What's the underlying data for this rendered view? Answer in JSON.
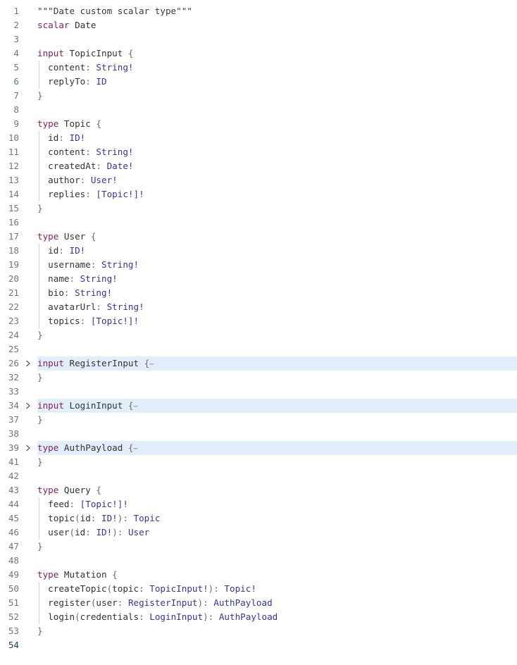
{
  "editor": {
    "lines": [
      {
        "n": "1",
        "tokens": [
          [
            "string",
            "\"\"\"Date custom scalar type\"\"\""
          ]
        ]
      },
      {
        "n": "2",
        "tokens": [
          [
            "keyword",
            "scalar"
          ],
          [
            "plain",
            " Date"
          ]
        ]
      },
      {
        "n": "3",
        "tokens": []
      },
      {
        "n": "4",
        "tokens": [
          [
            "keyword",
            "input"
          ],
          [
            "plain",
            " TopicInput "
          ],
          [
            "punct",
            "{"
          ]
        ]
      },
      {
        "n": "5",
        "guide": true,
        "tokens": [
          [
            "field",
            "  content"
          ],
          [
            "punct",
            ": "
          ],
          [
            "type",
            "String!"
          ]
        ]
      },
      {
        "n": "6",
        "guide": true,
        "tokens": [
          [
            "field",
            "  replyTo"
          ],
          [
            "punct",
            ": "
          ],
          [
            "type",
            "ID"
          ]
        ]
      },
      {
        "n": "7",
        "tokens": [
          [
            "punct",
            "}"
          ]
        ]
      },
      {
        "n": "8",
        "tokens": []
      },
      {
        "n": "9",
        "tokens": [
          [
            "keyword",
            "type"
          ],
          [
            "plain",
            " Topic "
          ],
          [
            "punct",
            "{"
          ]
        ]
      },
      {
        "n": "10",
        "guide": true,
        "tokens": [
          [
            "field",
            "  id"
          ],
          [
            "punct",
            ": "
          ],
          [
            "type",
            "ID!"
          ]
        ]
      },
      {
        "n": "11",
        "guide": true,
        "tokens": [
          [
            "field",
            "  content"
          ],
          [
            "punct",
            ": "
          ],
          [
            "type",
            "String!"
          ]
        ]
      },
      {
        "n": "12",
        "guide": true,
        "tokens": [
          [
            "field",
            "  createdAt"
          ],
          [
            "punct",
            ": "
          ],
          [
            "type",
            "Date!"
          ]
        ]
      },
      {
        "n": "13",
        "guide": true,
        "tokens": [
          [
            "field",
            "  author"
          ],
          [
            "punct",
            ": "
          ],
          [
            "type",
            "User!"
          ]
        ]
      },
      {
        "n": "14",
        "guide": true,
        "tokens": [
          [
            "field",
            "  replies"
          ],
          [
            "punct",
            ": "
          ],
          [
            "type",
            "[Topic!]!"
          ]
        ]
      },
      {
        "n": "15",
        "tokens": [
          [
            "punct",
            "}"
          ]
        ]
      },
      {
        "n": "16",
        "tokens": []
      },
      {
        "n": "17",
        "tokens": [
          [
            "keyword",
            "type"
          ],
          [
            "plain",
            " User "
          ],
          [
            "punct",
            "{"
          ]
        ]
      },
      {
        "n": "18",
        "guide": true,
        "tokens": [
          [
            "field",
            "  id"
          ],
          [
            "punct",
            ": "
          ],
          [
            "type",
            "ID!"
          ]
        ]
      },
      {
        "n": "19",
        "guide": true,
        "tokens": [
          [
            "field",
            "  username"
          ],
          [
            "punct",
            ": "
          ],
          [
            "type",
            "String!"
          ]
        ]
      },
      {
        "n": "20",
        "guide": true,
        "tokens": [
          [
            "field",
            "  name"
          ],
          [
            "punct",
            ": "
          ],
          [
            "type",
            "String!"
          ]
        ]
      },
      {
        "n": "21",
        "guide": true,
        "tokens": [
          [
            "field",
            "  bio"
          ],
          [
            "punct",
            ": "
          ],
          [
            "type",
            "String!"
          ]
        ]
      },
      {
        "n": "22",
        "guide": true,
        "tokens": [
          [
            "field",
            "  avatarUrl"
          ],
          [
            "punct",
            ": "
          ],
          [
            "type",
            "String!"
          ]
        ]
      },
      {
        "n": "23",
        "guide": true,
        "tokens": [
          [
            "field",
            "  topics"
          ],
          [
            "punct",
            ": "
          ],
          [
            "type",
            "[Topic!]!"
          ]
        ]
      },
      {
        "n": "24",
        "tokens": [
          [
            "punct",
            "}"
          ]
        ]
      },
      {
        "n": "25",
        "tokens": []
      },
      {
        "n": "26",
        "folded": true,
        "tokens": [
          [
            "keyword",
            "input"
          ],
          [
            "plain",
            " RegisterInput "
          ],
          [
            "punct",
            "{"
          ],
          [
            "ellipsis",
            "⋯"
          ]
        ]
      },
      {
        "n": "32",
        "tokens": [
          [
            "punct",
            "}"
          ]
        ]
      },
      {
        "n": "33",
        "tokens": []
      },
      {
        "n": "34",
        "folded": true,
        "tokens": [
          [
            "keyword",
            "input"
          ],
          [
            "plain",
            " LoginInput "
          ],
          [
            "punct",
            "{"
          ],
          [
            "ellipsis",
            "⋯"
          ]
        ]
      },
      {
        "n": "37",
        "tokens": [
          [
            "punct",
            "}"
          ]
        ]
      },
      {
        "n": "38",
        "tokens": []
      },
      {
        "n": "39",
        "folded": true,
        "tokens": [
          [
            "keyword",
            "type"
          ],
          [
            "plain",
            " AuthPayload "
          ],
          [
            "punct",
            "{"
          ],
          [
            "ellipsis",
            "⋯"
          ]
        ]
      },
      {
        "n": "41",
        "tokens": [
          [
            "punct",
            "}"
          ]
        ]
      },
      {
        "n": "42",
        "tokens": []
      },
      {
        "n": "43",
        "tokens": [
          [
            "keyword",
            "type"
          ],
          [
            "plain",
            " Query "
          ],
          [
            "punct",
            "{"
          ]
        ]
      },
      {
        "n": "44",
        "guide": true,
        "tokens": [
          [
            "field",
            "  feed"
          ],
          [
            "punct",
            ": "
          ],
          [
            "type",
            "[Topic!]!"
          ]
        ]
      },
      {
        "n": "45",
        "guide": true,
        "tokens": [
          [
            "field",
            "  topic"
          ],
          [
            "punct",
            "("
          ],
          [
            "field",
            "id"
          ],
          [
            "punct",
            ": "
          ],
          [
            "type",
            "ID!"
          ],
          [
            "punct",
            "): "
          ],
          [
            "type",
            "Topic"
          ]
        ]
      },
      {
        "n": "46",
        "guide": true,
        "tokens": [
          [
            "field",
            "  user"
          ],
          [
            "punct",
            "("
          ],
          [
            "field",
            "id"
          ],
          [
            "punct",
            ": "
          ],
          [
            "type",
            "ID!"
          ],
          [
            "punct",
            "): "
          ],
          [
            "type",
            "User"
          ]
        ]
      },
      {
        "n": "47",
        "tokens": [
          [
            "punct",
            "}"
          ]
        ]
      },
      {
        "n": "48",
        "tokens": []
      },
      {
        "n": "49",
        "tokens": [
          [
            "keyword",
            "type"
          ],
          [
            "plain",
            " Mutation "
          ],
          [
            "punct",
            "{"
          ]
        ]
      },
      {
        "n": "50",
        "guide": true,
        "tokens": [
          [
            "field",
            "  createTopic"
          ],
          [
            "punct",
            "("
          ],
          [
            "field",
            "topic"
          ],
          [
            "punct",
            ": "
          ],
          [
            "type",
            "TopicInput!"
          ],
          [
            "punct",
            "): "
          ],
          [
            "type",
            "Topic!"
          ]
        ]
      },
      {
        "n": "51",
        "guide": true,
        "tokens": [
          [
            "field",
            "  register"
          ],
          [
            "punct",
            "("
          ],
          [
            "field",
            "user"
          ],
          [
            "punct",
            ": "
          ],
          [
            "type",
            "RegisterInput"
          ],
          [
            "punct",
            "): "
          ],
          [
            "type",
            "AuthPayload"
          ]
        ]
      },
      {
        "n": "52",
        "guide": true,
        "tokens": [
          [
            "field",
            "  login"
          ],
          [
            "punct",
            "("
          ],
          [
            "field",
            "credentials"
          ],
          [
            "punct",
            ": "
          ],
          [
            "type",
            "LoginInput"
          ],
          [
            "punct",
            "): "
          ],
          [
            "type",
            "AuthPayload"
          ]
        ]
      },
      {
        "n": "53",
        "tokens": [
          [
            "punct",
            "}"
          ]
        ]
      },
      {
        "n": "54",
        "active": true,
        "tokens": []
      }
    ]
  },
  "icons": {
    "fold": "chevron-right-icon"
  },
  "colors": {
    "background": "#ffffff",
    "line_number": "#6e7681",
    "active_line_number": "#1f3a5f",
    "keyword": "#8a1f5e",
    "type": "#3434a8",
    "text": "#333333",
    "folded_highlight": "#e3eefb"
  }
}
